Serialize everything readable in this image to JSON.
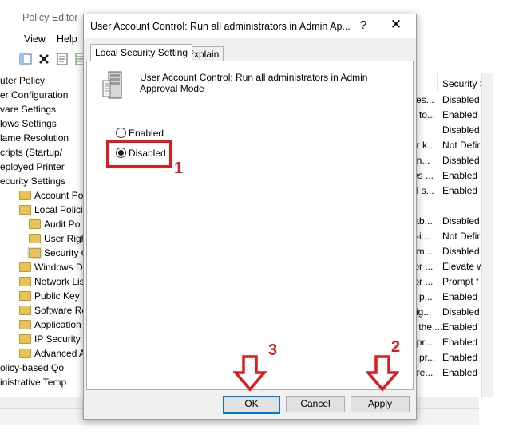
{
  "background_app": {
    "title": "Policy Editor",
    "minimize": "—",
    "menu": [
      "View",
      "Help"
    ],
    "tree": [
      {
        "label": "uter Policy",
        "indent": 0,
        "folder": false
      },
      {
        "label": "er Configuration",
        "indent": 0,
        "folder": false
      },
      {
        "label": "vare Settings",
        "indent": 0,
        "folder": false
      },
      {
        "label": "lows Settings",
        "indent": 0,
        "folder": false
      },
      {
        "label": "lame Resolution",
        "indent": 0,
        "folder": false
      },
      {
        "label": "cripts (Startup/",
        "indent": 0,
        "folder": false
      },
      {
        "label": "eployed Printer",
        "indent": 0,
        "folder": false
      },
      {
        "label": "ecurity Settings",
        "indent": 0,
        "folder": false
      },
      {
        "label": "Account Poli",
        "indent": 1,
        "folder": true
      },
      {
        "label": "Local Policie",
        "indent": 1,
        "folder": true
      },
      {
        "label": "Audit Po",
        "indent": 2,
        "folder": true
      },
      {
        "label": "User Righ",
        "indent": 2,
        "folder": true
      },
      {
        "label": "Security C",
        "indent": 2,
        "folder": true,
        "selected": true
      },
      {
        "label": "Windows De",
        "indent": 1,
        "folder": true
      },
      {
        "label": "Network List",
        "indent": 1,
        "folder": true
      },
      {
        "label": "Public Key P",
        "indent": 1,
        "folder": true
      },
      {
        "label": "Software Res",
        "indent": 1,
        "folder": true
      },
      {
        "label": "Application C",
        "indent": 1,
        "folder": true
      },
      {
        "label": "IP Security P",
        "indent": 1,
        "folder": true
      },
      {
        "label": "Advanced Au",
        "indent": 1,
        "folder": true
      },
      {
        "label": "olicy-based Qo",
        "indent": 0,
        "folder": false
      },
      {
        "label": "inistrative Temp",
        "indent": 0,
        "folder": false
      }
    ],
    "column_header": "Security S",
    "rows": [
      {
        "policy_tail": "ves...",
        "setting": "Disabled"
      },
      {
        "policy_tail": "g to...",
        "setting": "Enabled"
      },
      {
        "policy_tail": "",
        "setting": "Disabled"
      },
      {
        "policy_tail": "er k...",
        "setting": "Not Defir"
      },
      {
        "policy_tail": "en...",
        "setting": "Disabled"
      },
      {
        "policy_tail": "ws ...",
        "setting": "Enabled"
      },
      {
        "policy_tail": "al s...",
        "setting": "Enabled"
      },
      {
        "policy_tail": "",
        "setting": ""
      },
      {
        "policy_tail": "tab...",
        "setting": "Disabled"
      },
      {
        "policy_tail": "lt-i...",
        "setting": "Not Defir"
      },
      {
        "policy_tail": "om...",
        "setting": "Disabled"
      },
      {
        "policy_tail": "for ...",
        "setting": "Elevate w"
      },
      {
        "policy_tail": "for ...",
        "setting": "Prompt f"
      },
      {
        "policy_tail": "d p...",
        "setting": "Enabled"
      },
      {
        "policy_tail": "sig...",
        "setting": "Disabled"
      },
      {
        "policy_tail": "s the ...",
        "setting": "Enabled"
      },
      {
        "policy_tail": "ppr...",
        "setting": "Enabled"
      },
      {
        "policy_tail": "n pr...",
        "setting": "Enabled"
      },
      {
        "policy_tail": "ure...",
        "setting": "Enabled"
      }
    ]
  },
  "dialog": {
    "title": "User Account Control: Run all administrators in Admin Ap...",
    "help_glyph": "?",
    "close_glyph": "✕",
    "tabs": [
      "Local Security Setting",
      "Explain"
    ],
    "policy_name": "User Account Control: Run all administrators in Admin Approval Mode",
    "options": [
      {
        "label": "Enabled",
        "selected": false
      },
      {
        "label": "Disabled",
        "selected": true
      }
    ],
    "buttons": {
      "ok": "OK",
      "cancel": "Cancel",
      "apply": "Apply"
    }
  },
  "annotations": {
    "color": "#e01b1b",
    "step1": "1",
    "step2": "2",
    "step3": "3"
  }
}
